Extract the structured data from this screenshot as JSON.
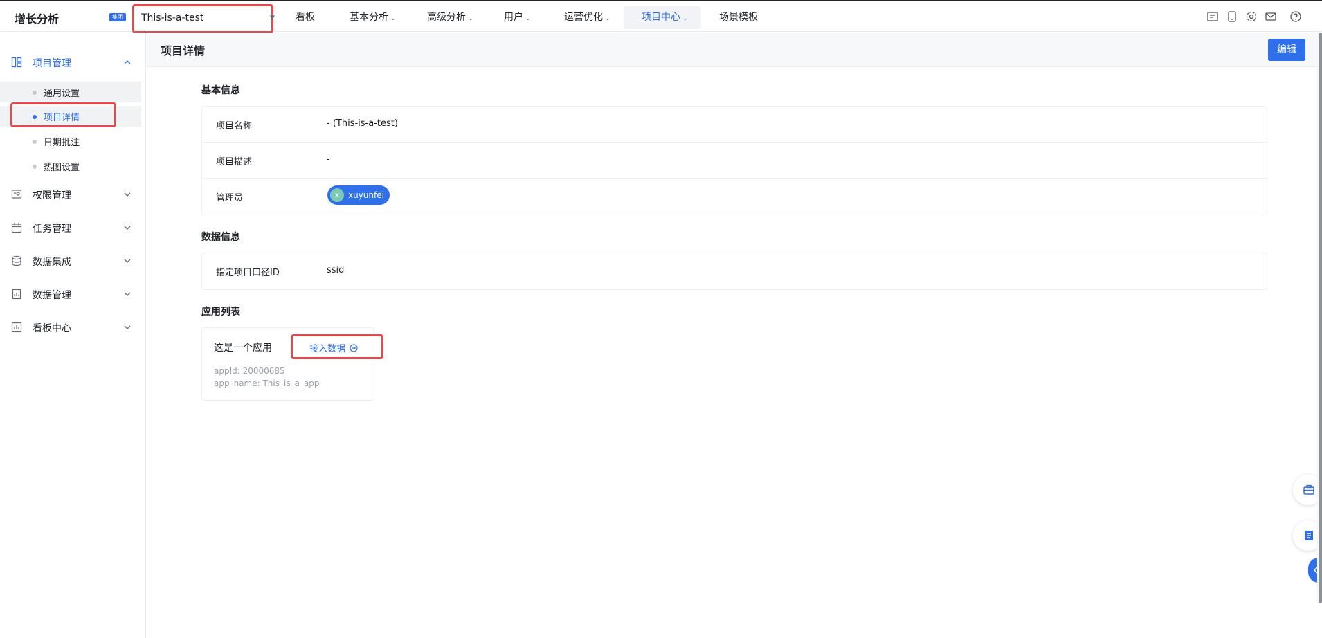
{
  "app": {
    "brand": "增长分析",
    "badge": "集团"
  },
  "project_selector": {
    "value": "This-is-a-test"
  },
  "nav": {
    "items": [
      {
        "label": "看板"
      },
      {
        "label": "基本分析"
      },
      {
        "label": "高级分析"
      },
      {
        "label": "用户"
      },
      {
        "label": "运营优化"
      },
      {
        "label": "项目中心"
      },
      {
        "label": "场景模板"
      }
    ],
    "active": "项目中心"
  },
  "toolbar_icons": [
    "report-icon",
    "mobile-icon",
    "settings-icon",
    "mail-icon",
    "help-icon"
  ],
  "sidebar": {
    "groups": [
      {
        "label": "项目管理",
        "icon": "layout-icon",
        "expanded": true
      },
      {
        "label": "权限管理",
        "icon": "permission-icon",
        "expanded": false
      },
      {
        "label": "任务管理",
        "icon": "calendar-icon",
        "expanded": false
      },
      {
        "label": "数据集成",
        "icon": "database-icon",
        "expanded": false
      },
      {
        "label": "数据管理",
        "icon": "document-icon",
        "expanded": false
      },
      {
        "label": "看板中心",
        "icon": "chart-icon",
        "expanded": false
      }
    ],
    "sub_items": [
      {
        "label": "通用设置"
      },
      {
        "label": "项目详情"
      },
      {
        "label": "日期批注"
      },
      {
        "label": "热图设置"
      }
    ],
    "active_sub": "项目详情"
  },
  "page": {
    "title": "项目详情",
    "edit_label": "编辑"
  },
  "basic_info": {
    "title": "基本信息",
    "rows": [
      {
        "label": "项目名称",
        "value": "- (This-is-a-test)"
      },
      {
        "label": "项目描述",
        "value": "-"
      },
      {
        "label": "管理员",
        "value": "xuyunfei",
        "avatar": "x"
      }
    ]
  },
  "data_info": {
    "title": "数据信息",
    "rows": [
      {
        "label": "指定项目口径ID",
        "value": "ssid"
      }
    ]
  },
  "app_list": {
    "title": "应用列表",
    "apps": [
      {
        "name": "这是一个应用",
        "link": "接入数据",
        "appid": "appId: 20000685",
        "app_name": "app_name: This_is_a_app"
      }
    ]
  },
  "colors": {
    "accent": "#2f6fea",
    "highlight": "#e5484d"
  }
}
